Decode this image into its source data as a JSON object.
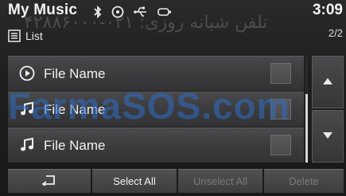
{
  "header": {
    "title": "My Music",
    "clock": "3:09",
    "mode_label": "List",
    "page_indicator": "2/2",
    "status_icons": [
      "bluetooth-icon",
      "disc-icon",
      "usb-icon",
      "ipod-icon"
    ]
  },
  "watermark": {
    "main": "FarmaSOS.com",
    "persian": "تلفن شبانه روزی: ۰۲۱-۴۲۸۸۶۰۰۰"
  },
  "list": {
    "items": [
      {
        "label": "File Name",
        "icon": "play-circle-icon",
        "checked": false
      },
      {
        "label": "File Name",
        "icon": "music-note-icon",
        "checked": false
      },
      {
        "label": "File Name",
        "icon": "music-note-icon",
        "checked": false
      }
    ]
  },
  "scroll": {
    "up_icon": "arrow-up-icon",
    "down_icon": "arrow-down-icon"
  },
  "bottom_bar": {
    "back_icon": "back-arrow-icon",
    "select_all": "Select All",
    "unselect_all": "Unselect All",
    "delete": "Delete"
  },
  "colors": {
    "background": "#1b1b1c",
    "row": "#3b3b3d",
    "text": "#f2f2f2",
    "disabled_text": "#7a7a7c",
    "watermark_blue": "#2d6ec8"
  }
}
